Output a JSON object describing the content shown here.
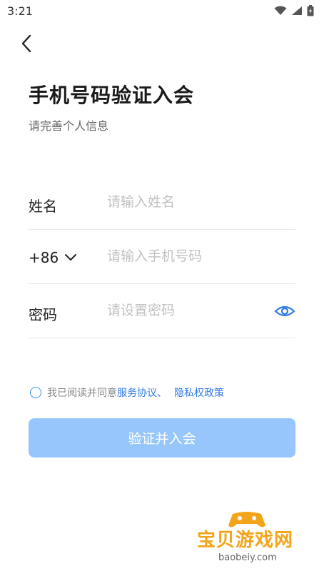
{
  "status_bar": {
    "time": "3:21"
  },
  "header": {
    "title": "手机号码验证入会",
    "subtitle": "请完善个人信息"
  },
  "form": {
    "name": {
      "label": "姓名",
      "placeholder": "请输入姓名"
    },
    "phone": {
      "country_code": "+86",
      "placeholder": "请输入手机号码"
    },
    "password": {
      "label": "密码",
      "placeholder": "请设置密码"
    }
  },
  "agreement": {
    "prefix": "我已阅读并同意",
    "service_link": "服务协议、",
    "privacy_link": "隐私权政策"
  },
  "submit_label": "验证并入会",
  "watermark": {
    "text": "宝贝游戏网",
    "url": "baobeiy.com"
  },
  "colors": {
    "accent": "#2c7be5",
    "button": "#96c6fb",
    "watermark": "#f2a51a"
  }
}
